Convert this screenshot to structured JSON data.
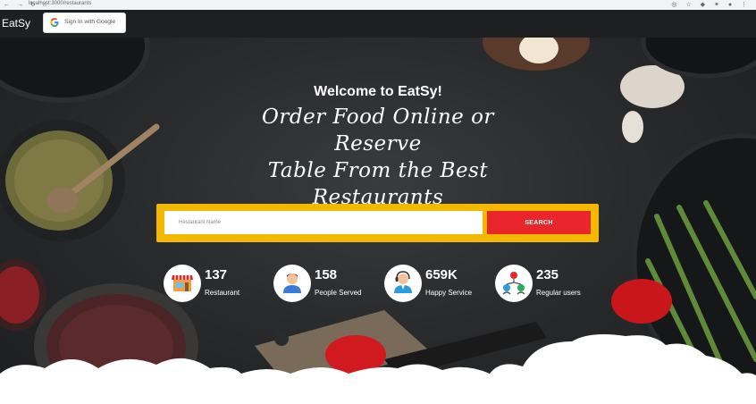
{
  "browser": {
    "url": "localhost:3000/restaurants"
  },
  "header": {
    "brand": "EatSy",
    "google_button_label": "Sign In with Google"
  },
  "hero": {
    "welcome": "Welcome to EatSy!",
    "tagline_line1": "Order Food Online or Reserve",
    "tagline_line2": "Table From the Best",
    "tagline_line3": "Restaurants"
  },
  "search": {
    "placeholder": "Restaurant Name",
    "button_label": "SEARCH"
  },
  "stats": [
    {
      "number": "137",
      "label": "Restaurant",
      "icon": "storefront-icon"
    },
    {
      "number": "158",
      "label": "People Served",
      "icon": "person-icon"
    },
    {
      "number": "659K",
      "label": "Happy Service",
      "icon": "support-agent-icon"
    },
    {
      "number": "235",
      "label": "Regular users",
      "icon": "users-network-icon"
    }
  ],
  "colors": {
    "header_bg": "#1e1f21",
    "search_frame": "#f5b800",
    "search_button": "#e8262b"
  }
}
